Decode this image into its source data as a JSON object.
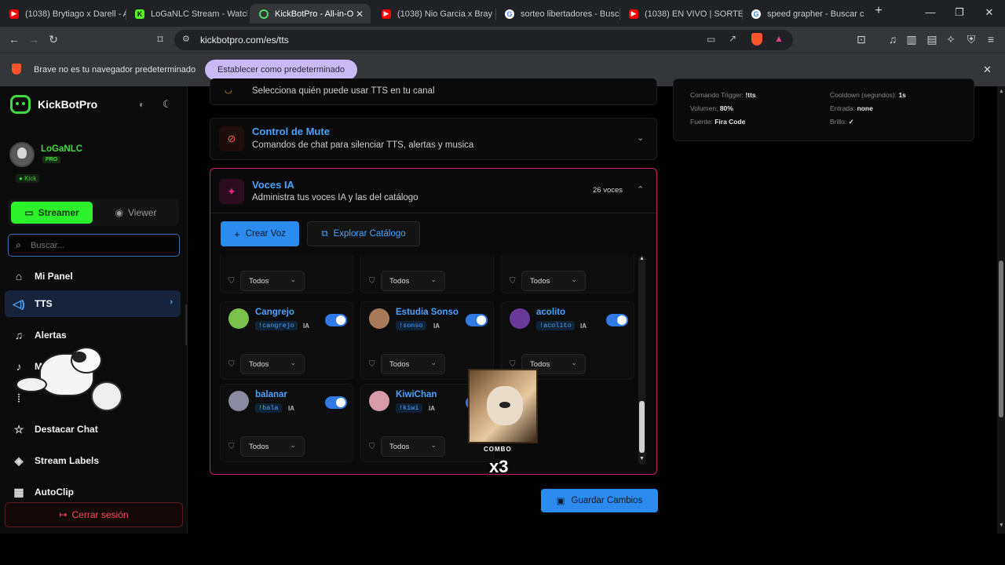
{
  "browser": {
    "tabs": [
      {
        "title": "(1038) Brytiago x Darell - A",
        "favicon": "youtube"
      },
      {
        "title": "LoGaNLC Stream - Watch",
        "favicon": "kick"
      },
      {
        "title": "KickBotPro - All-in-O",
        "favicon": "kickbot"
      },
      {
        "title": "(1038) Nio Garcia x Bray x",
        "favicon": "youtube"
      },
      {
        "title": "sorteo libertadores - Busca",
        "favicon": "google"
      },
      {
        "title": "(1038) EN VIVO | SORTEO L",
        "favicon": "youtube"
      },
      {
        "title": "speed grapher - Buscar co",
        "favicon": "google"
      }
    ],
    "new_tab": "+",
    "url": "kickbotpro.com/es/tts",
    "infobar_text": "Brave no es tu navegador predeterminado",
    "infobar_button": "Establecer como predeterminado"
  },
  "sidebar": {
    "brand": "KickBotPro",
    "user": {
      "name": "LoGaNLC",
      "badge": "PRO",
      "platform": "Kick"
    },
    "mode_streamer": "Streamer",
    "mode_viewer": "Viewer",
    "search_placeholder": "Buscar...",
    "items": [
      {
        "label": "Mi Panel",
        "icon": "home-icon"
      },
      {
        "label": "TTS",
        "icon": "speaker-icon"
      },
      {
        "label": "Alertas",
        "icon": "bell-icon"
      },
      {
        "label": "Música",
        "icon": "music-icon"
      },
      {
        "label": "",
        "icon": "waveform-icon"
      },
      {
        "label": "Destacar Chat",
        "icon": "star-icon"
      },
      {
        "label": "Stream Labels",
        "icon": "tag-icon"
      },
      {
        "label": "AutoClip",
        "icon": "film-icon"
      }
    ],
    "logout": "Cerrar sesión"
  },
  "main": {
    "permissions_subtitle": "Selecciona quién puede usar TTS en tu canal",
    "mute": {
      "title": "Control de Mute",
      "subtitle": "Comandos de chat para silenciar TTS, alertas y musica"
    },
    "voices": {
      "title": "Voces IA",
      "subtitle": "Administra tus voces IA y las del catálogo",
      "count": "26 voces",
      "create_button": "Crear Voz",
      "explore_button": "Explorar Catálogo",
      "dropdown_default": "Todos",
      "items": [
        {
          "name": "Cangrejo",
          "command": "!cangrejo",
          "tag": "IA",
          "enabled": true,
          "permission": "Todos"
        },
        {
          "name": "Estudia Sonso",
          "command": "!sonso",
          "tag": "IA",
          "enabled": true,
          "permission": "Todos"
        },
        {
          "name": "acolito",
          "command": "!acolito",
          "tag": "IA",
          "enabled": true,
          "permission": "Todos"
        },
        {
          "name": "balanar",
          "command": "!bala",
          "tag": "IA",
          "enabled": true,
          "permission": "Todos"
        },
        {
          "name": "KiwiChan",
          "command": "!kiwi",
          "tag": "IA",
          "enabled": true,
          "permission": "Todos"
        }
      ]
    },
    "save_button": "Guardar Cambios",
    "settings_summary": {
      "trigger_label": "Comando Trigger:",
      "trigger_value": "!tts",
      "cooldown_label": "Cooldown (segundos):",
      "cooldown_value": "1s",
      "volume_label": "Volumen:",
      "volume_value": "80%",
      "input_label": "Entrada:",
      "input_value": "none",
      "font_label": "Fuente:",
      "font_value": "Fira Code",
      "brightness_label": "Brillo:",
      "brightness_value": "✓"
    }
  },
  "overlay": {
    "combo_label": "COMBO",
    "combo_count": "x3"
  },
  "colors": {
    "accent": "#4aa3ff",
    "streamer_green": "#2cf22c",
    "voices_border": "#e0267a",
    "logout_red": "#ff4d5a"
  }
}
